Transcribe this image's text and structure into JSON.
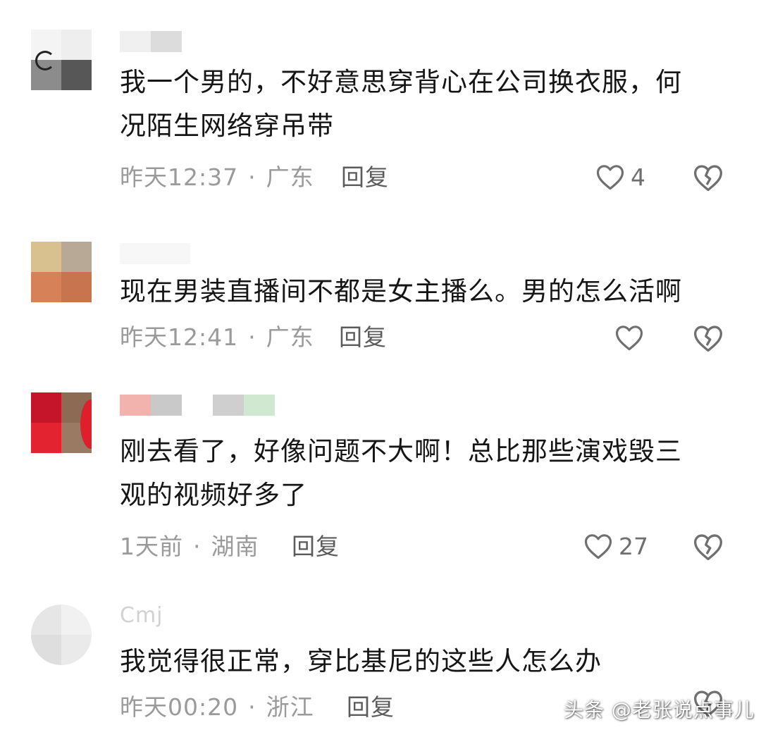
{
  "comments": [
    {
      "username": "",
      "text": "我一个男的，不好意思穿背心在公司换衣服，何\n况陌生网络穿吊带",
      "time": "昨天12:37",
      "location": "广东",
      "reply_label": "回复",
      "likes": "4"
    },
    {
      "username": "",
      "text": "现在男装直播间不都是女主播么。男的怎么活啊",
      "time": "昨天12:41",
      "location": "广东",
      "reply_label": "回复",
      "likes": ""
    },
    {
      "username": "",
      "text": "刚去看了，好像问题不大啊！总比那些演戏毁三\n观的视频好多了",
      "time": "1天前",
      "location": "湖南",
      "reply_label": "回复",
      "likes": "27"
    },
    {
      "username": "Cmj",
      "text": "我觉得很正常，穿比基尼的这些人怎么办",
      "time": "昨天00:20",
      "location": "浙江",
      "reply_label": "回复",
      "likes": ""
    }
  ],
  "separator": "·",
  "watermark": "头条 @老张说点事儿",
  "icons": {
    "like": "heart-outline-icon",
    "dislike": "broken-heart-icon"
  },
  "colors": {
    "meta": "#9a9a9a",
    "icon": "#6f6f6f",
    "text": "#151515"
  }
}
